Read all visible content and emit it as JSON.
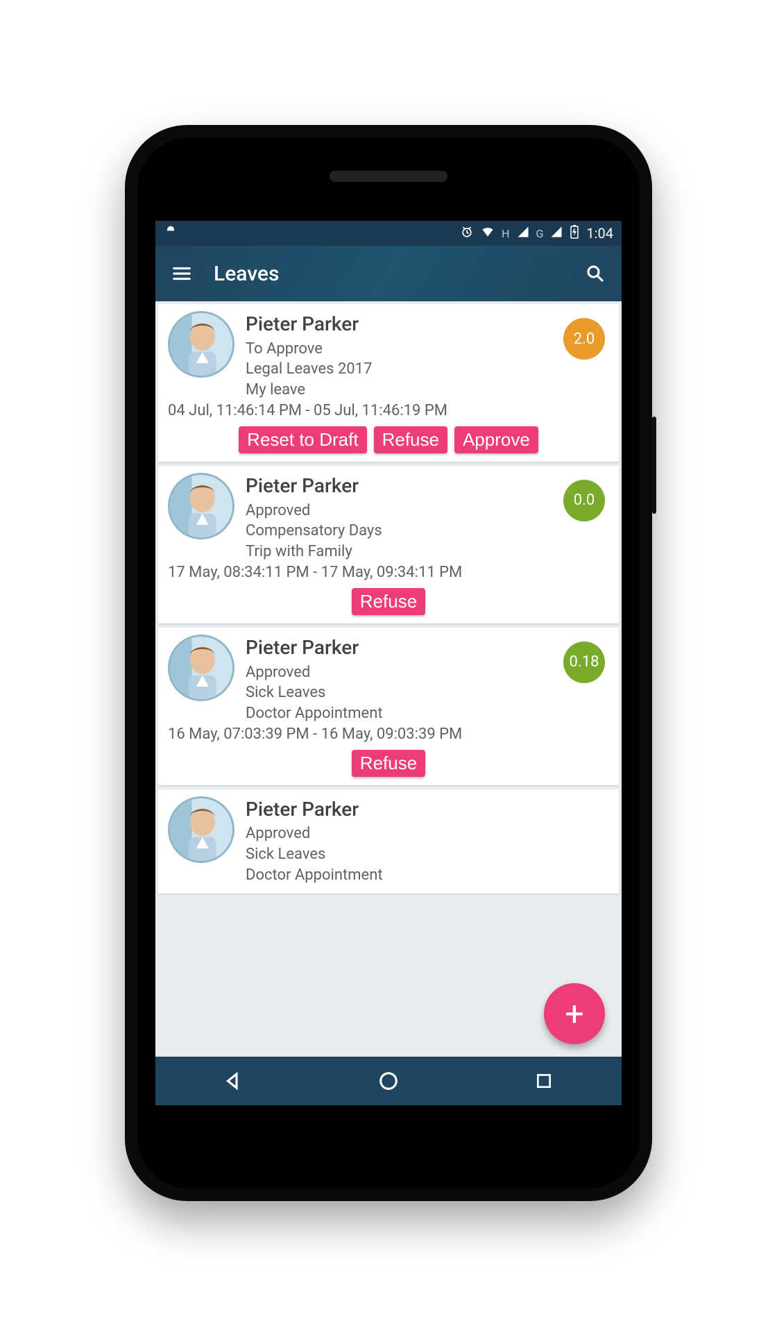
{
  "status": {
    "time": "1:04",
    "net1": "H",
    "net2": "G"
  },
  "header": {
    "title": "Leaves"
  },
  "colors": {
    "orange": "#e89a2b",
    "green": "#7aab2a",
    "pink": "#ec3d78"
  },
  "leaves": [
    {
      "name": "Pieter Parker",
      "status": "To Approve",
      "type": "Legal Leaves 2017",
      "reason": "My leave",
      "dates": "04 Jul, 11:46:14 PM - 05 Jul, 11:46:19 PM",
      "badge_value": "2.0",
      "badge_color": "#e89a2b",
      "actions": [
        "Reset to Draft",
        "Refuse",
        "Approve"
      ]
    },
    {
      "name": "Pieter Parker",
      "status": "Approved",
      "type": "Compensatory Days",
      "reason": "Trip with Family",
      "dates": "17 May, 08:34:11 PM - 17 May, 09:34:11 PM",
      "badge_value": "0.0",
      "badge_color": "#7aab2a",
      "actions": [
        "Refuse"
      ]
    },
    {
      "name": "Pieter Parker",
      "status": "Approved",
      "type": "Sick Leaves",
      "reason": "Doctor Appointment",
      "dates": "16 May, 07:03:39 PM - 16 May, 09:03:39 PM",
      "badge_value": "0.18",
      "badge_color": "#7aab2a",
      "actions": [
        "Refuse"
      ]
    },
    {
      "name": "Pieter Parker",
      "status": "Approved",
      "type": "Sick Leaves",
      "reason": "Doctor Appointment",
      "dates": "",
      "badge_value": "",
      "badge_color": "",
      "actions": []
    }
  ],
  "fab": {
    "label": "+"
  }
}
